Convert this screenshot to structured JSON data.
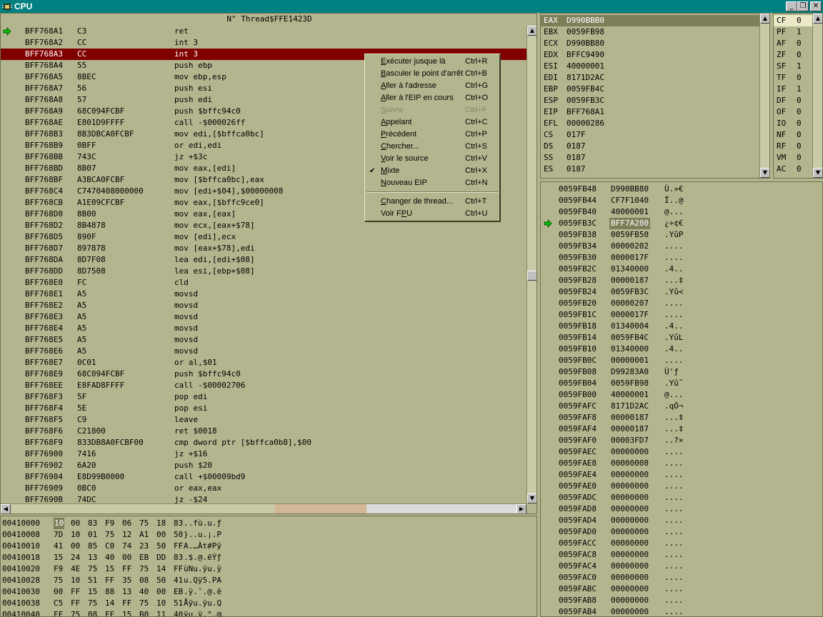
{
  "window": {
    "title": "CPU",
    "buttons": {
      "minimize": "_",
      "restore": "❐",
      "close": "✕"
    }
  },
  "disasm": {
    "header": "N° Thread$FFE1423D",
    "current_ip_marker": "arrow-right-icon",
    "selected_row": 2,
    "rows": [
      {
        "addr": "BFF768A1",
        "bytes": "C3",
        "instr": "ret"
      },
      {
        "addr": "BFF768A2",
        "bytes": "CC",
        "instr": "int 3"
      },
      {
        "addr": "BFF768A3",
        "bytes": "CC",
        "instr": "int 3"
      },
      {
        "addr": "BFF768A4",
        "bytes": "55",
        "instr": "push ebp"
      },
      {
        "addr": "BFF768A5",
        "bytes": "8BEC",
        "instr": "mov ebp,esp"
      },
      {
        "addr": "BFF768A7",
        "bytes": "56",
        "instr": "push esi"
      },
      {
        "addr": "BFF768A8",
        "bytes": "57",
        "instr": "push edi"
      },
      {
        "addr": "BFF768A9",
        "bytes": "68C094FCBF",
        "instr": "push $bffc94c0"
      },
      {
        "addr": "BFF768AE",
        "bytes": "E801D9FFFF",
        "instr": "call -$000026ff"
      },
      {
        "addr": "BFF768B3",
        "bytes": "8B3DBCA0FCBF",
        "instr": "mov edi,[$bffca0bc]"
      },
      {
        "addr": "BFF768B9",
        "bytes": "0BFF",
        "instr": "or edi,edi"
      },
      {
        "addr": "BFF768BB",
        "bytes": "743C",
        "instr": "jz +$3c"
      },
      {
        "addr": "BFF768BD",
        "bytes": "8B07",
        "instr": "mov eax,[edi]"
      },
      {
        "addr": "BFF768BF",
        "bytes": "A3BCA0FCBF",
        "instr": "mov [$bffca0bc],eax"
      },
      {
        "addr": "BFF768C4",
        "bytes": "C7470408000000",
        "instr": "mov [edi+$04],$00000008"
      },
      {
        "addr": "BFF768CB",
        "bytes": "A1E09CFCBF",
        "instr": "mov eax,[$bffc9ce0]"
      },
      {
        "addr": "BFF768D0",
        "bytes": "8B00",
        "instr": "mov eax,[eax]"
      },
      {
        "addr": "BFF768D2",
        "bytes": "8B4878",
        "instr": "mov ecx,[eax+$78]"
      },
      {
        "addr": "BFF768D5",
        "bytes": "890F",
        "instr": "mov [edi],ecx"
      },
      {
        "addr": "BFF768D7",
        "bytes": "897878",
        "instr": "mov [eax+$78],edi"
      },
      {
        "addr": "BFF768DA",
        "bytes": "8D7F08",
        "instr": "lea edi,[edi+$08]"
      },
      {
        "addr": "BFF768DD",
        "bytes": "8D7508",
        "instr": "lea esi,[ebp+$08]"
      },
      {
        "addr": "BFF768E0",
        "bytes": "FC",
        "instr": "cld"
      },
      {
        "addr": "BFF768E1",
        "bytes": "A5",
        "instr": "movsd"
      },
      {
        "addr": "BFF768E2",
        "bytes": "A5",
        "instr": "movsd"
      },
      {
        "addr": "BFF768E3",
        "bytes": "A5",
        "instr": "movsd"
      },
      {
        "addr": "BFF768E4",
        "bytes": "A5",
        "instr": "movsd"
      },
      {
        "addr": "BFF768E5",
        "bytes": "A5",
        "instr": "movsd"
      },
      {
        "addr": "BFF768E6",
        "bytes": "A5",
        "instr": "movsd"
      },
      {
        "addr": "BFF768E7",
        "bytes": "0C01",
        "instr": "or al,$01"
      },
      {
        "addr": "BFF768E9",
        "bytes": "68C094FCBF",
        "instr": "push $bffc94c0"
      },
      {
        "addr": "BFF768EE",
        "bytes": "E8FAD8FFFF",
        "instr": "call -$00002706"
      },
      {
        "addr": "BFF768F3",
        "bytes": "5F",
        "instr": "pop edi"
      },
      {
        "addr": "BFF768F4",
        "bytes": "5E",
        "instr": "pop esi"
      },
      {
        "addr": "BFF768F5",
        "bytes": "C9",
        "instr": "leave"
      },
      {
        "addr": "BFF768F6",
        "bytes": "C21800",
        "instr": "ret $0018"
      },
      {
        "addr": "BFF768F9",
        "bytes": "833DB8A0FCBF00",
        "instr": "cmp dword ptr [$bffca0b8],$00"
      },
      {
        "addr": "BFF76900",
        "bytes": "7416",
        "instr": "jz +$16"
      },
      {
        "addr": "BFF76902",
        "bytes": "6A20",
        "instr": "push $20"
      },
      {
        "addr": "BFF76904",
        "bytes": "E8D99B0000",
        "instr": "call +$00009bd9"
      },
      {
        "addr": "BFF76909",
        "bytes": "0BC0",
        "instr": "or eax,eax"
      },
      {
        "addr": "BFF7690B",
        "bytes": "74DC",
        "instr": "jz -$24"
      }
    ]
  },
  "context_menu": {
    "items": [
      {
        "label": "Exécuter jusque là",
        "shortcut": "Ctrl+R",
        "enabled": true,
        "checked": false,
        "ul": 0
      },
      {
        "label": "Basculer le point d'arrêt",
        "shortcut": "Ctrl+B",
        "enabled": true,
        "checked": false,
        "ul": 0
      },
      {
        "label": "Aller à l'adresse",
        "shortcut": "Ctrl+G",
        "enabled": true,
        "checked": false,
        "ul": 0
      },
      {
        "label": "Aller à l'EIP en cours",
        "shortcut": "Ctrl+O",
        "enabled": true,
        "checked": false,
        "ul": 0
      },
      {
        "label": "Suivre",
        "shortcut": "Ctrl+F",
        "enabled": false,
        "checked": false,
        "ul": 0
      },
      {
        "label": "Appelant",
        "shortcut": "Ctrl+C",
        "enabled": true,
        "checked": false,
        "ul": 0
      },
      {
        "label": "Précédent",
        "shortcut": "Ctrl+P",
        "enabled": true,
        "checked": false,
        "ul": 0
      },
      {
        "label": "Chercher...",
        "shortcut": "Ctrl+S",
        "enabled": true,
        "checked": false,
        "ul": 0
      },
      {
        "label": "Voir le source",
        "shortcut": "Ctrl+V",
        "enabled": true,
        "checked": false,
        "ul": 0
      },
      {
        "label": "Mixte",
        "shortcut": "Ctrl+X",
        "enabled": true,
        "checked": true,
        "ul": 0
      },
      {
        "label": "Nouveau EIP",
        "shortcut": "Ctrl+N",
        "enabled": true,
        "checked": false,
        "ul": 0
      },
      {
        "label": "Changer de thread...",
        "shortcut": "Ctrl+T",
        "enabled": true,
        "checked": false,
        "ul": 0
      },
      {
        "label": "Voir FPU",
        "shortcut": "Ctrl+U",
        "enabled": true,
        "checked": false,
        "ul": 6
      }
    ]
  },
  "memory_dump": {
    "rows": [
      {
        "addr": "00410000",
        "bytes": [
          "10",
          "00",
          "83",
          "F9",
          "06",
          "75",
          "18",
          "83"
        ],
        "ascii": "..fù.u.ƒ"
      },
      {
        "addr": "00410008",
        "bytes": [
          "7D",
          "10",
          "01",
          "75",
          "12",
          "A1",
          "00",
          "50"
        ],
        "ascii": "}..u.¡.P"
      },
      {
        "addr": "00410010",
        "bytes": [
          "41",
          "00",
          "85",
          "C0",
          "74",
          "23",
          "50",
          "FF"
        ],
        "ascii": "A.…Àt#Pÿ"
      },
      {
        "addr": "00410018",
        "bytes": [
          "15",
          "24",
          "13",
          "40",
          "00",
          "EB",
          "DD",
          "83"
        ],
        "ascii": ".$.@.ëÝƒ"
      },
      {
        "addr": "00410020",
        "bytes": [
          "F9",
          "4E",
          "75",
          "15",
          "FF",
          "75",
          "14",
          "FF"
        ],
        "ascii": "ùNu.ÿu.ÿ"
      },
      {
        "addr": "00410028",
        "bytes": [
          "75",
          "10",
          "51",
          "FF",
          "35",
          "08",
          "50",
          "41"
        ],
        "ascii": "u.Qÿ5.PA"
      },
      {
        "addr": "00410030",
        "bytes": [
          "00",
          "FF",
          "15",
          "88",
          "13",
          "40",
          "00",
          "EB"
        ],
        "ascii": ".ÿ.ˆ.@.ë"
      },
      {
        "addr": "00410038",
        "bytes": [
          "C5",
          "FF",
          "75",
          "14",
          "FF",
          "75",
          "10",
          "51"
        ],
        "ascii": "Åÿu.ÿu.Q"
      },
      {
        "addr": "00410040",
        "bytes": [
          "FF",
          "75",
          "08",
          "FF",
          "15",
          "B0",
          "11",
          "40"
        ],
        "ascii": "ÿu.ÿ.°.@"
      }
    ]
  },
  "registers": {
    "rows": [
      {
        "name": "EAX",
        "value": "D990BBB0"
      },
      {
        "name": "EBX",
        "value": "0059FB98"
      },
      {
        "name": "ECX",
        "value": "D990BB80"
      },
      {
        "name": "EDX",
        "value": "BFFC9490"
      },
      {
        "name": "ESI",
        "value": "40000001"
      },
      {
        "name": "EDI",
        "value": "8171D2AC"
      },
      {
        "name": "EBP",
        "value": "0059FB4C"
      },
      {
        "name": "ESP",
        "value": "0059FB3C"
      },
      {
        "name": "EIP",
        "value": "BFF768A1"
      },
      {
        "name": "EFL",
        "value": "00000286"
      },
      {
        "name": "CS",
        "value": "017F"
      },
      {
        "name": "DS",
        "value": "0187"
      },
      {
        "name": "SS",
        "value": "0187"
      },
      {
        "name": "ES",
        "value": "0187"
      }
    ]
  },
  "flags": {
    "rows": [
      {
        "name": "CF",
        "value": "0"
      },
      {
        "name": "PF",
        "value": "1"
      },
      {
        "name": "AF",
        "value": "0"
      },
      {
        "name": "ZF",
        "value": "0"
      },
      {
        "name": "SF",
        "value": "1"
      },
      {
        "name": "TF",
        "value": "0"
      },
      {
        "name": "IF",
        "value": "1"
      },
      {
        "name": "DF",
        "value": "0"
      },
      {
        "name": "OF",
        "value": "0"
      },
      {
        "name": "IO",
        "value": "0"
      },
      {
        "name": "NF",
        "value": "0"
      },
      {
        "name": "RF",
        "value": "0"
      },
      {
        "name": "VM",
        "value": "0"
      },
      {
        "name": "AC",
        "value": "0"
      }
    ]
  },
  "stack": {
    "marker_row": 3,
    "highlight_row": 3,
    "rows": [
      {
        "addr": "0059FB48",
        "value": "D990BB80",
        "ascii": "Ù.»€"
      },
      {
        "addr": "0059FB44",
        "value": "CF7F1040",
        "ascii": "Ï..@"
      },
      {
        "addr": "0059FB40",
        "value": "40000001",
        "ascii": "@..."
      },
      {
        "addr": "0059FB3C",
        "value": "BFF7A280",
        "ascii": "¿÷¢€"
      },
      {
        "addr": "0059FB38",
        "value": "0059FB50",
        "ascii": ".YûP"
      },
      {
        "addr": "0059FB34",
        "value": "00000202",
        "ascii": "...."
      },
      {
        "addr": "0059FB30",
        "value": "0000017F",
        "ascii": "...."
      },
      {
        "addr": "0059FB2C",
        "value": "01340000",
        "ascii": ".4.."
      },
      {
        "addr": "0059FB28",
        "value": "00000187",
        "ascii": "...‡"
      },
      {
        "addr": "0059FB24",
        "value": "0059FB3C",
        "ascii": ".Yû<"
      },
      {
        "addr": "0059FB20",
        "value": "00000207",
        "ascii": "...."
      },
      {
        "addr": "0059FB1C",
        "value": "0000017F",
        "ascii": "...."
      },
      {
        "addr": "0059FB18",
        "value": "01340004",
        "ascii": ".4.."
      },
      {
        "addr": "0059FB14",
        "value": "0059FB4C",
        "ascii": ".YûL"
      },
      {
        "addr": "0059FB10",
        "value": "01340000",
        "ascii": ".4.."
      },
      {
        "addr": "0059FB0C",
        "value": "00000001",
        "ascii": "...."
      },
      {
        "addr": "0059FB08",
        "value": "D99283A0",
        "ascii": "Ù'ƒ "
      },
      {
        "addr": "0059FB04",
        "value": "0059FB98",
        "ascii": ".Yû˜"
      },
      {
        "addr": "0059FB00",
        "value": "40000001",
        "ascii": "@..."
      },
      {
        "addr": "0059FAFC",
        "value": "8171D2AC",
        "ascii": ".qÒ¬"
      },
      {
        "addr": "0059FAF8",
        "value": "00000187",
        "ascii": "...‡"
      },
      {
        "addr": "0059FAF4",
        "value": "00000187",
        "ascii": "...‡"
      },
      {
        "addr": "0059FAF0",
        "value": "00003FD7",
        "ascii": "..?×"
      },
      {
        "addr": "0059FAEC",
        "value": "00000000",
        "ascii": "...."
      },
      {
        "addr": "0059FAE8",
        "value": "00000008",
        "ascii": "...."
      },
      {
        "addr": "0059FAE4",
        "value": "00000000",
        "ascii": "...."
      },
      {
        "addr": "0059FAE0",
        "value": "00000000",
        "ascii": "...."
      },
      {
        "addr": "0059FADC",
        "value": "00000000",
        "ascii": "...."
      },
      {
        "addr": "0059FAD8",
        "value": "00000000",
        "ascii": "...."
      },
      {
        "addr": "0059FAD4",
        "value": "00000000",
        "ascii": "...."
      },
      {
        "addr": "0059FAD0",
        "value": "00000000",
        "ascii": "...."
      },
      {
        "addr": "0059FACC",
        "value": "00000000",
        "ascii": "...."
      },
      {
        "addr": "0059FAC8",
        "value": "00000000",
        "ascii": "...."
      },
      {
        "addr": "0059FAC4",
        "value": "00000000",
        "ascii": "...."
      },
      {
        "addr": "0059FAC0",
        "value": "00000000",
        "ascii": "...."
      },
      {
        "addr": "0059FABC",
        "value": "00000000",
        "ascii": "...."
      },
      {
        "addr": "0059FAB8",
        "value": "00000000",
        "ascii": "...."
      },
      {
        "addr": "0059FAB4",
        "value": "00000000",
        "ascii": "...."
      }
    ]
  },
  "colors": {
    "background": "#b3b58e",
    "selection_row": "#800000",
    "titlebar": "#008080",
    "highlight_cell": "#7d7f5a",
    "current_ip_arrow": "#00c000"
  }
}
